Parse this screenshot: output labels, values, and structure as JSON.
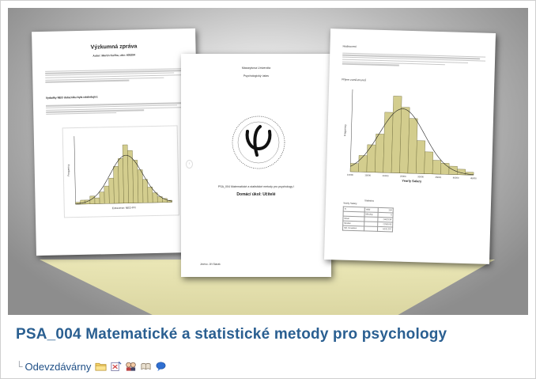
{
  "course": {
    "title": "PSA_004 Matematické a statistické metody pro psychology",
    "section_link": "Odevzdávárny"
  },
  "icons": [
    "folder-icon",
    "quiz-icon",
    "forum-icon",
    "glossary-icon",
    "chat-icon"
  ],
  "colors": {
    "title_blue": "#2a5f91",
    "link_blue": "#1f4f86",
    "bar_fill": "#d3cd8e",
    "bar_stroke": "#6e6a3c"
  },
  "documents": {
    "left": {
      "title": "Výzkumná zpráva",
      "author": "Autor: Martin Kučka, uko: 409294",
      "heading": "Vydadky NEO dotazníku byla následující:"
    },
    "middle": {
      "university": "Masarykova Univerzita",
      "institute": "Psychologický ústav",
      "course_line": "PSA_004 Matematické a statistické metody pro psychology I",
      "homework": "Domácí úkol: Učitelé",
      "author": "Jméno: Jiří Starák"
    },
    "right": {
      "heading": "Hodnocení",
      "label": "Příjem zaměstnanců",
      "axis_title": "Yearly Salary",
      "stats_title": "Statistics",
      "stats_subtitle": "Yearly Salary",
      "stats_rows": [
        {
          "label": "N",
          "sub": "Valid",
          "value": "134"
        },
        {
          "label": "",
          "sub": "Missing",
          "value": "0"
        },
        {
          "label": "Mean",
          "sub": "",
          "value": "24625.94"
        },
        {
          "label": "Median",
          "sub": "",
          "value": "22500.00"
        },
        {
          "label": "Std. Deviation",
          "sub": "",
          "value": "6131.257"
        }
      ]
    }
  },
  "chart_data": [
    {
      "type": "bar",
      "title": "",
      "xlabel": "Extraverze: NEO-FFI",
      "ylabel": "Frequency",
      "values": [
        1,
        2,
        2,
        4,
        3,
        6,
        9,
        13,
        19,
        23,
        30,
        27,
        22,
        17,
        12,
        8,
        5,
        3,
        2,
        1
      ],
      "normal_curve": true,
      "ylim": [
        0,
        35
      ]
    },
    {
      "type": "bar",
      "title": "",
      "xlabel": "Yearly Salary",
      "ylabel": "Frequency",
      "x_ticks": [
        "10000",
        "15000",
        "20000",
        "25000",
        "30000",
        "35000",
        "40000",
        "45000"
      ],
      "values": [
        3,
        6,
        10,
        14,
        22,
        28,
        24,
        20,
        12,
        8,
        5,
        4,
        3,
        2,
        1
      ],
      "normal_curve": true,
      "ylim": [
        0,
        30
      ]
    }
  ]
}
